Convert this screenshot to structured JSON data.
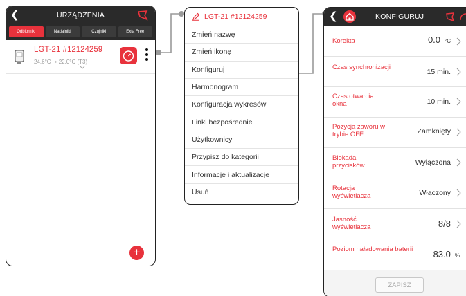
{
  "devices_screen": {
    "title": "URZĄDZENIA",
    "tabs": [
      {
        "label": "Odbiorniki",
        "active": true
      },
      {
        "label": "Nadajniki",
        "active": false
      },
      {
        "label": "Czujniki",
        "active": false
      },
      {
        "label": "Exta Free",
        "active": false
      }
    ],
    "device": {
      "name": "LGT-21 #12124259",
      "temperature": "24.6°C ➞ 22.0°C (T3)"
    },
    "add_label": "+"
  },
  "menu_screen": {
    "header": "LGT-21 #12124259",
    "items": [
      "Zmień nazwę",
      "Zmień ikonę",
      "Konfiguruj",
      "Harmonogram",
      "Konfiguracja wykresów",
      "Linki bezpośrednie",
      "Użytkownicy",
      "Przypisz do kategorii",
      "Informacje i aktualizacje",
      "Usuń"
    ]
  },
  "config_screen": {
    "title": "KONFIGURUJ",
    "rows": [
      {
        "label": "Korekta",
        "value": "0.0",
        "unit": "°C"
      },
      {
        "label": "Czas synchronizacji",
        "value": "15 min."
      },
      {
        "label": "Czas otwarcia okna",
        "value": "10 min."
      },
      {
        "label": "Pozycja zaworu w trybie OFF",
        "value": "Zamknięty"
      },
      {
        "label": "Blokada przycisków",
        "value": "Wyłączona"
      },
      {
        "label": "Rotacja wyświetlacza",
        "value": "Włączony"
      },
      {
        "label": "Jasność wyświetlacza",
        "value": "8/8"
      },
      {
        "label": "Poziom naładowania baterii",
        "value": "83.0",
        "unit": "%"
      }
    ],
    "save_label": "ZAPISZ"
  },
  "colors": {
    "accent": "#e8323c",
    "header_bg": "#2a2a2a",
    "connector": "#9a9a9a"
  }
}
